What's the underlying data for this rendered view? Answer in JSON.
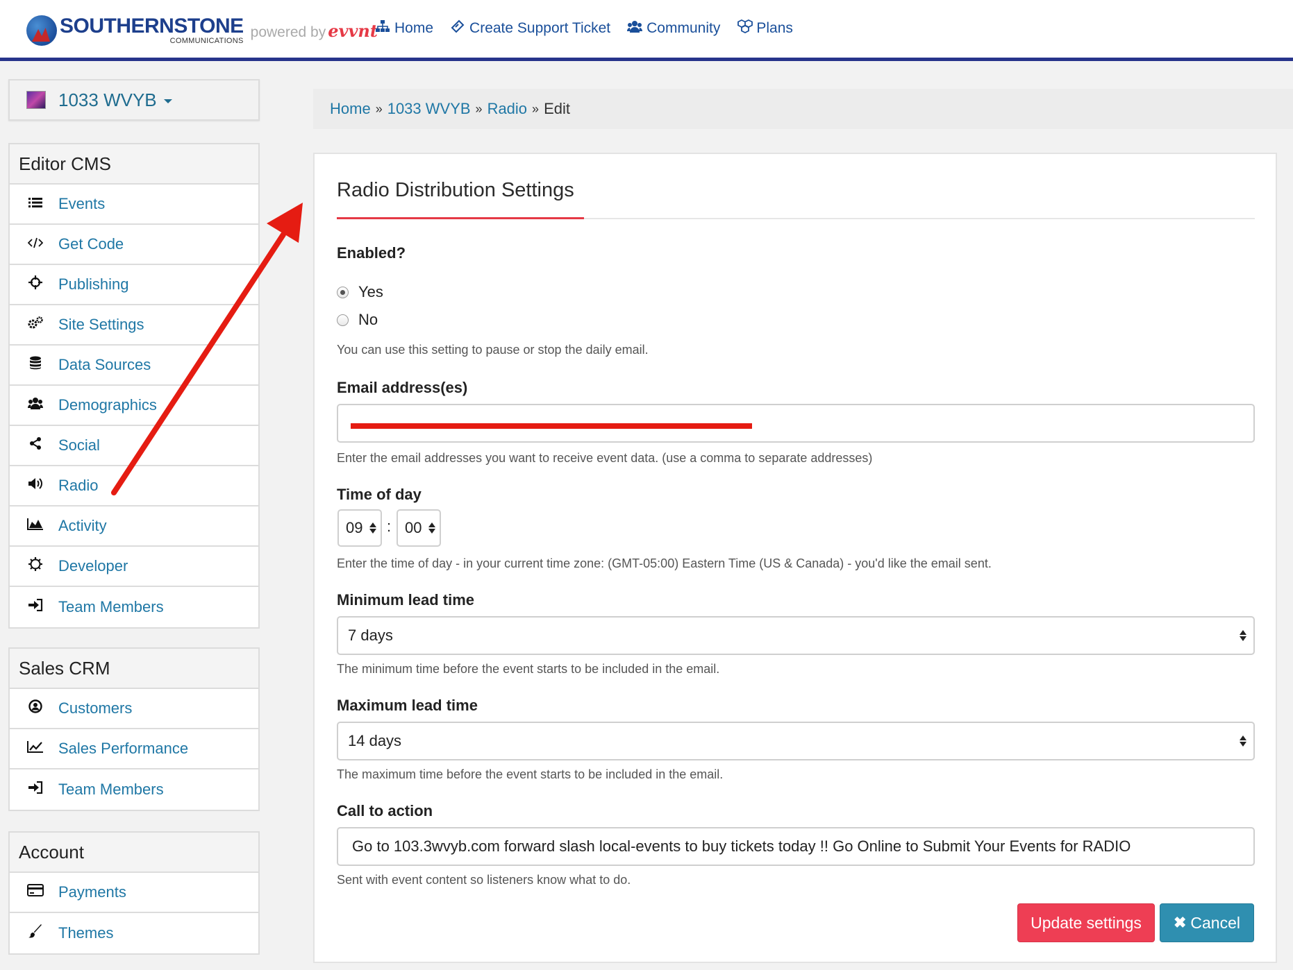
{
  "brand": {
    "name": "SOUTHERNSTONE",
    "sub": "COMMUNICATIONS",
    "powered_prefix": "powered by",
    "powered_logo": "evvnt"
  },
  "nav": [
    {
      "label": "Home",
      "icon": "sitemap-icon"
    },
    {
      "label": "Create Support Ticket",
      "icon": "ticket-icon"
    },
    {
      "label": "Community",
      "icon": "users-icon"
    },
    {
      "label": "Plans",
      "icon": "cubes-icon"
    }
  ],
  "site": {
    "name": "1033 WVYB"
  },
  "sidebar": {
    "editor": {
      "title": "Editor CMS",
      "items": [
        {
          "label": "Events",
          "icon": "list-icon"
        },
        {
          "label": "Get Code",
          "icon": "code-icon"
        },
        {
          "label": "Publishing",
          "icon": "crosshairs-icon"
        },
        {
          "label": "Site Settings",
          "icon": "gears-icon"
        },
        {
          "label": "Data Sources",
          "icon": "database-icon"
        },
        {
          "label": "Demographics",
          "icon": "users-icon"
        },
        {
          "label": "Social",
          "icon": "share-icon"
        },
        {
          "label": "Radio",
          "icon": "volume-icon"
        },
        {
          "label": "Activity",
          "icon": "area-chart-icon"
        },
        {
          "label": "Developer",
          "icon": "cog-icon"
        },
        {
          "label": "Team Members",
          "icon": "sign-in-icon"
        }
      ]
    },
    "sales": {
      "title": "Sales CRM",
      "items": [
        {
          "label": "Customers",
          "icon": "user-circle-icon"
        },
        {
          "label": "Sales Performance",
          "icon": "line-chart-icon"
        },
        {
          "label": "Team Members",
          "icon": "sign-in-icon"
        }
      ]
    },
    "account": {
      "title": "Account",
      "items": [
        {
          "label": "Payments",
          "icon": "credit-card-icon"
        },
        {
          "label": "Themes",
          "icon": "paint-brush-icon"
        }
      ]
    }
  },
  "breadcrumb": {
    "items": [
      "Home",
      "1033 WVYB",
      "Radio"
    ],
    "separator": "»",
    "current": "Edit"
  },
  "form": {
    "title": "Radio Distribution Settings",
    "enabled": {
      "label": "Enabled?",
      "options": [
        "Yes",
        "No"
      ],
      "selected": "Yes",
      "help": "You can use this setting to pause or stop the daily email."
    },
    "email": {
      "label": "Email address(es)",
      "help": "Enter the email addresses you want to receive event data. (use a comma to separate addresses)"
    },
    "time": {
      "label": "Time of day",
      "hour": "09",
      "minute": "00",
      "separator": ":",
      "help": "Enter the time of day - in your current time zone: (GMT-05:00) Eastern Time (US & Canada) - you'd like the email sent."
    },
    "min_lead": {
      "label": "Minimum lead time",
      "value": "7 days",
      "help": "The minimum time before the event starts to be included in the email."
    },
    "max_lead": {
      "label": "Maximum lead time",
      "value": "14 days",
      "help": "The maximum time before the event starts to be included in the email."
    },
    "cta": {
      "label": "Call to action",
      "value": "Go to 103.3wvyb.com forward slash local-events to buy tickets today !! Go Online to Submit Your Events for RADIO",
      "help": "Sent with event content so listeners know what to do."
    },
    "buttons": {
      "update": "Update settings",
      "cancel_icon": "✖",
      "cancel": "Cancel"
    }
  },
  "colors": {
    "accent_blue": "#1f77a5",
    "nav_blue": "#1a4f9a",
    "brand_bar": "#27348b",
    "update_red": "#ee3e54",
    "cancel_teal": "#2f8fb0",
    "annotation_red": "#e51c12"
  }
}
